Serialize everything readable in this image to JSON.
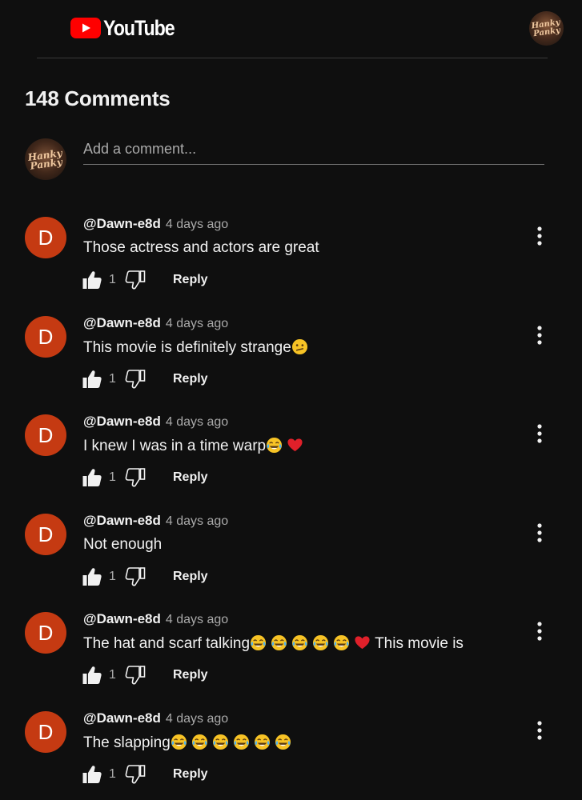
{
  "header": {
    "logo_text": "YouTube",
    "brand_color": "#ff0000",
    "avatar_text": "Hanky Panky"
  },
  "comments_count": "148 Comments",
  "add_comment": {
    "placeholder": "Add a comment...",
    "avatar_text": "Hanky Panky"
  },
  "comments": [
    {
      "avatar_letter": "D",
      "author": "@Dawn-e8d",
      "time": "4 days ago",
      "text": "Those actress and actors are great",
      "emojis": [],
      "trailing_text": "",
      "likes": "1",
      "reply_label": "Reply"
    },
    {
      "avatar_letter": "D",
      "author": "@Dawn-e8d",
      "time": "4 days ago",
      "text": "This movie is definitely strange",
      "emojis": [
        "confused-face"
      ],
      "trailing_text": "",
      "likes": "1",
      "reply_label": "Reply"
    },
    {
      "avatar_letter": "D",
      "author": "@Dawn-e8d",
      "time": "4 days ago",
      "text": "I knew I was in a time warp",
      "emojis": [
        "tears-of-joy",
        "red-heart"
      ],
      "trailing_text": "",
      "likes": "1",
      "reply_label": "Reply"
    },
    {
      "avatar_letter": "D",
      "author": "@Dawn-e8d",
      "time": "4 days ago",
      "text": "Not enough",
      "emojis": [],
      "trailing_text": "",
      "likes": "1",
      "reply_label": "Reply"
    },
    {
      "avatar_letter": "D",
      "author": "@Dawn-e8d",
      "time": "4 days ago",
      "text": "The hat and scarf talking",
      "emojis": [
        "tears-of-joy",
        "tears-of-joy",
        "tears-of-joy",
        "tears-of-joy",
        "tears-of-joy",
        "red-heart"
      ],
      "trailing_text": "This movie is",
      "likes": "1",
      "reply_label": "Reply"
    },
    {
      "avatar_letter": "D",
      "author": "@Dawn-e8d",
      "time": "4 days ago",
      "text": "The slapping",
      "emojis": [
        "tears-of-joy",
        "tears-of-joy",
        "tears-of-joy",
        "tears-of-joy",
        "tears-of-joy",
        "tears-of-joy"
      ],
      "trailing_text": "",
      "likes": "1",
      "reply_label": "Reply"
    }
  ],
  "colors": {
    "background": "#0f0f0f",
    "avatar_bg": "#c53a12",
    "secondary_text": "#aaaaaa"
  }
}
